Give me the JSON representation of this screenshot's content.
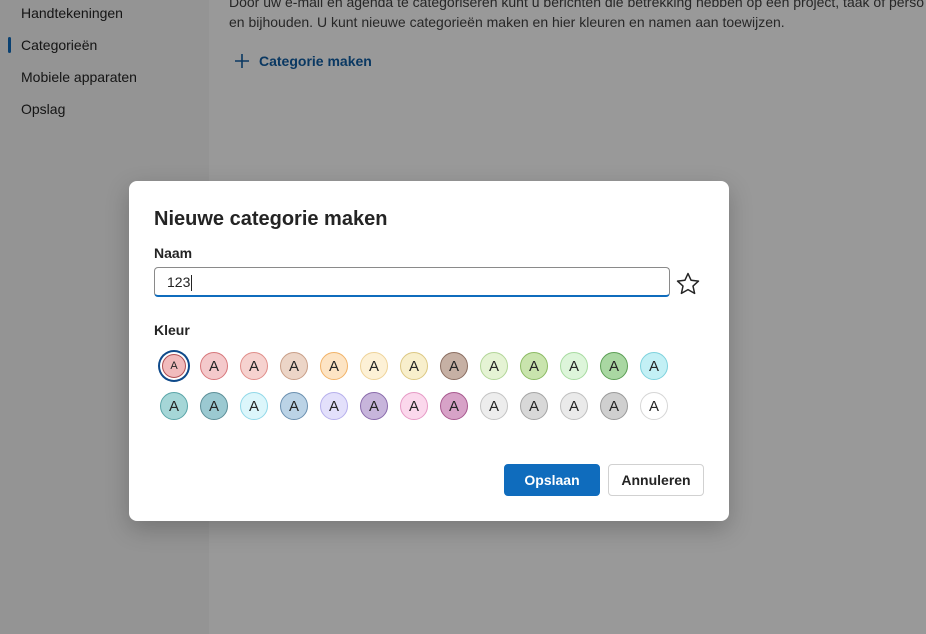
{
  "sidebar": {
    "items": [
      {
        "label": "Handtekeningen"
      },
      {
        "label": "Categorieën"
      },
      {
        "label": "Mobiele apparaten"
      },
      {
        "label": "Opslag"
      }
    ]
  },
  "main": {
    "description": "Door uw e-mail en agenda te categoriseren kunt u berichten die betrekking hebben op een project, taak of perso\nen bijhouden. U kunt nieuwe categorieën maken en hier kleuren en namen aan toewijzen.",
    "create_label": "Categorie maken"
  },
  "dialog": {
    "title": "Nieuwe categorie maken",
    "name_label": "Naam",
    "name_value": "123",
    "color_label": "Kleur",
    "swatch_letter": "A",
    "save_label": "Opslaan",
    "cancel_label": "Annuleren"
  },
  "colors": {
    "accent": "#0f6cbd",
    "swatches": [
      {
        "bg": "#f1bbbc",
        "border": "#b14f52"
      },
      {
        "bg": "#f4c9cb",
        "border": "#d7777b"
      },
      {
        "bg": "#f6d2cf",
        "border": "#e08e8a"
      },
      {
        "bg": "#ecd5c7",
        "border": "#c99f88"
      },
      {
        "bg": "#fde4c4",
        "border": "#f1b369"
      },
      {
        "bg": "#fdf1d6",
        "border": "#eed39a"
      },
      {
        "bg": "#f8efcc",
        "border": "#dcc884"
      },
      {
        "bg": "#c6b0a4",
        "border": "#8b6e61"
      },
      {
        "bg": "#e5f3d4",
        "border": "#b3d699"
      },
      {
        "bg": "#c9e4ad",
        "border": "#8cbb64"
      },
      {
        "bg": "#ddf5da",
        "border": "#a8dba1"
      },
      {
        "bg": "#a9d7a2",
        "border": "#5c9f55"
      },
      {
        "bg": "#c3f0f5",
        "border": "#7fd2dd"
      },
      {
        "bg": "#a5d6d7",
        "border": "#5aa5a8"
      },
      {
        "bg": "#9bc9d1",
        "border": "#5c8f98"
      },
      {
        "bg": "#dcf6fb",
        "border": "#92d8e8"
      },
      {
        "bg": "#bbd3e6",
        "border": "#6b90b0"
      },
      {
        "bg": "#e3e0fb",
        "border": "#b7b0ec"
      },
      {
        "bg": "#c7b5db",
        "border": "#8a6bac"
      },
      {
        "bg": "#fbd8ec",
        "border": "#e69bc6"
      },
      {
        "bg": "#d7a2c7",
        "border": "#a8598f"
      },
      {
        "bg": "#ededed",
        "border": "#c4c4c4"
      },
      {
        "bg": "#d8d8d8",
        "border": "#a5a5a5"
      },
      {
        "bg": "#eaeaea",
        "border": "#c0c0c0"
      },
      {
        "bg": "#cfcfcf",
        "border": "#9a9a9a"
      },
      {
        "bg": "#ffffff",
        "border": "#d6d6d6"
      }
    ],
    "selected_index": 0
  }
}
